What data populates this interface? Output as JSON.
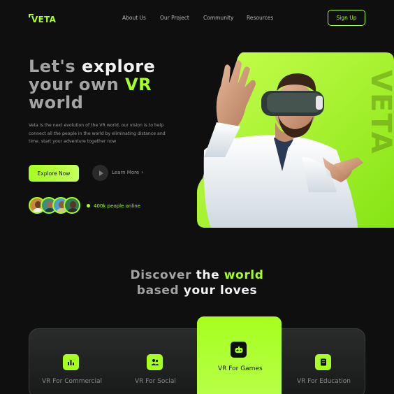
{
  "brand": {
    "name": "VETA",
    "accent": "#a6ff1e"
  },
  "nav": {
    "links": [
      "About Us",
      "Our Project",
      "Community",
      "Resources"
    ],
    "signup_label": "Sign Up"
  },
  "hero": {
    "title_line1_a": "Let's",
    "title_line1_b": "explore",
    "title_line2_a": "your own",
    "title_line2_b": "VR",
    "title_line3": "world",
    "description": "Veta is the next evolution of the VR world, our vision is to help connect all the people in the world by eliminating distance and time. start your adventure together now",
    "explore_label": "Explore Now",
    "learn_label": "Learn More",
    "learn_chevron": "›",
    "online_text": "400k people online",
    "watermark": "VETA"
  },
  "discover": {
    "line1_a": "Discover",
    "line1_b": "the",
    "line1_c": "world",
    "line2_a": "based",
    "line2_b": "your loves"
  },
  "categories": [
    {
      "label": "VR For Commercial",
      "icon": "chart-icon"
    },
    {
      "label": "VR For Social",
      "icon": "people-icon"
    },
    {
      "label": "VR For Games",
      "icon": "gamepad-icon",
      "active": true
    },
    {
      "label": "VR For Education",
      "icon": "book-icon"
    }
  ]
}
